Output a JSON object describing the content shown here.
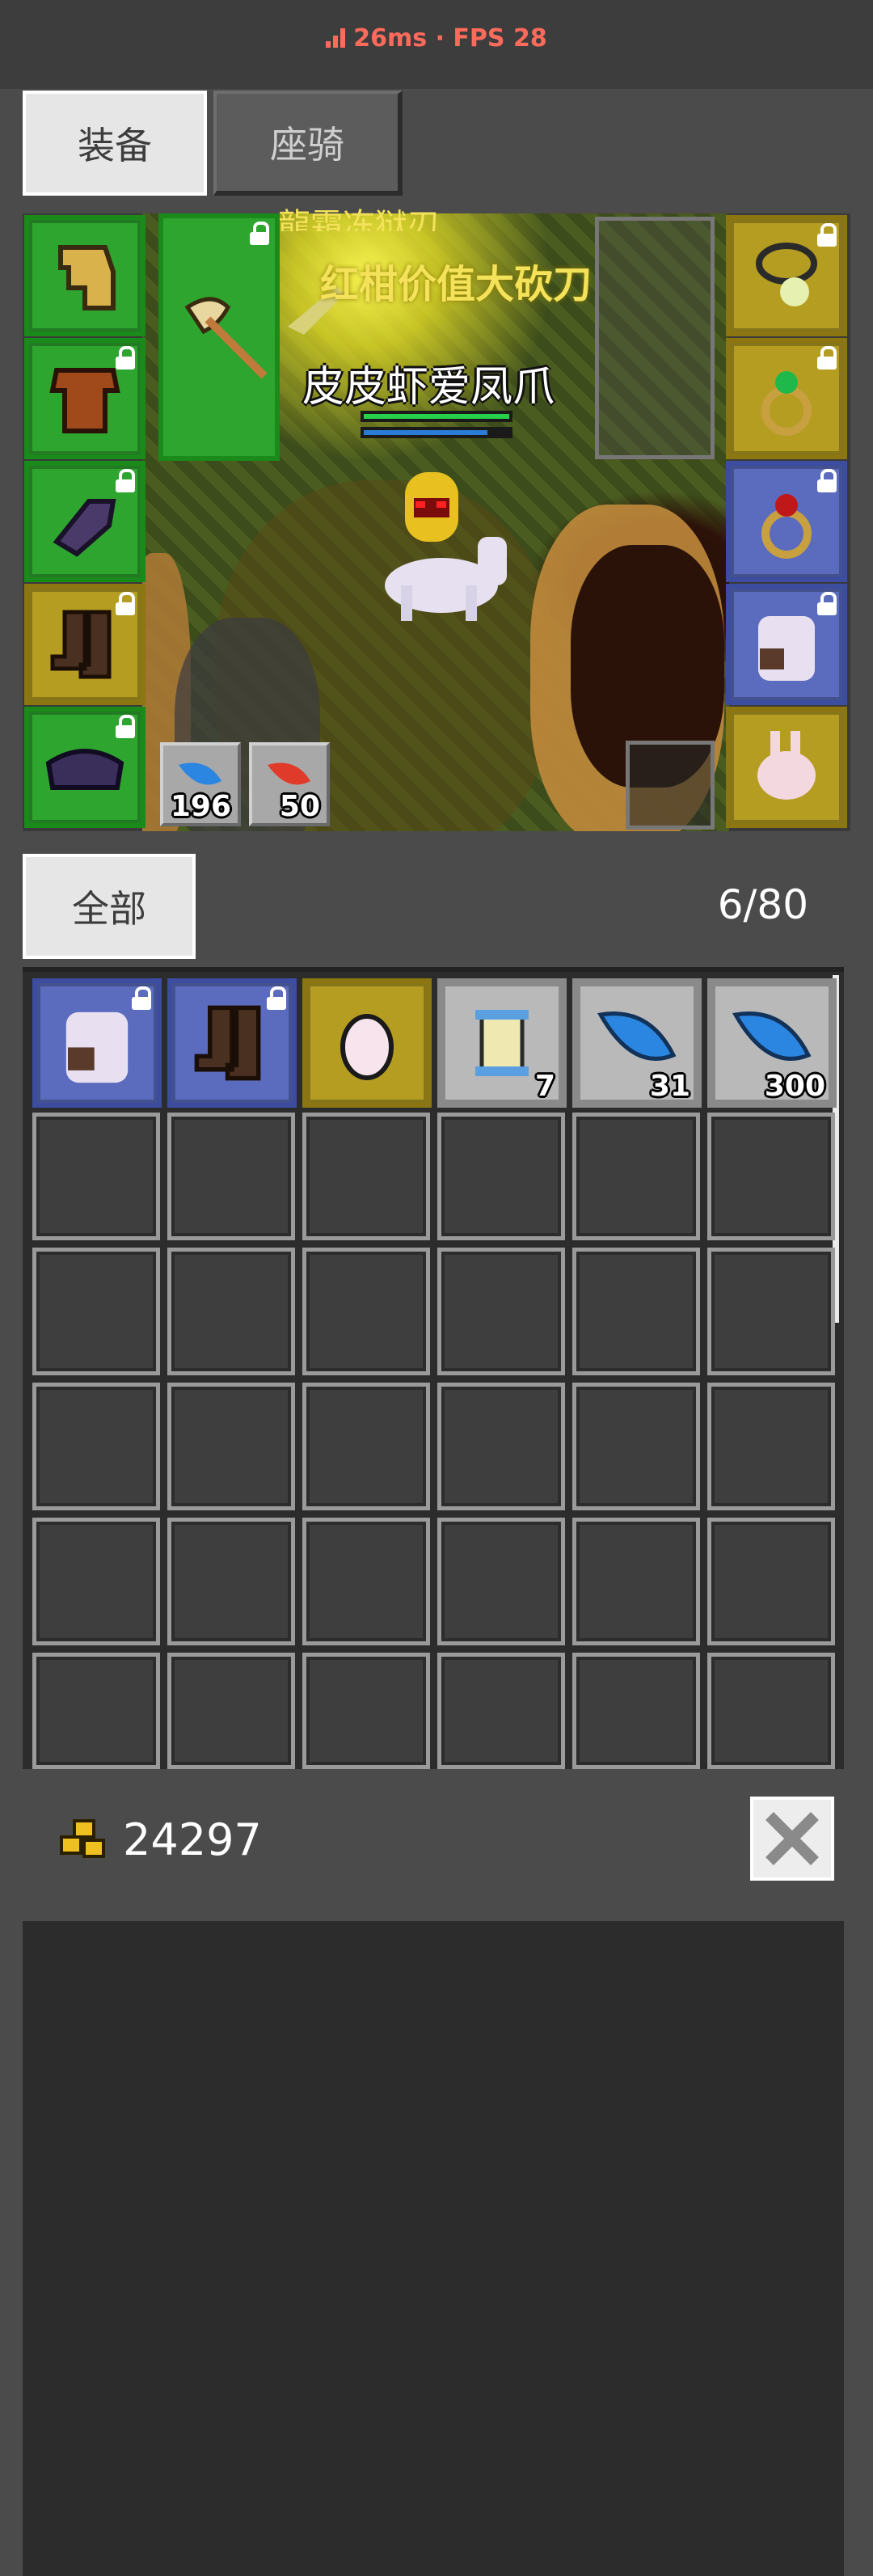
{
  "header": {
    "fps_text": "26ms · FPS 28"
  },
  "tabs": [
    {
      "label": "装备",
      "active": true
    },
    {
      "label": "座骑",
      "active": false
    }
  ],
  "scene": {
    "banner_top": "龍霜冻狱刃",
    "banner": "红柑价值大砍刀",
    "player_name": "皮皮虾爱凤爪",
    "hp_fraction": 1.0,
    "mp_fraction": 0.85
  },
  "equipment": {
    "left_slots": [
      {
        "name": "helmet",
        "color": "green",
        "locked": false,
        "icon": "helmet-icon"
      },
      {
        "name": "armor",
        "color": "green",
        "locked": true,
        "icon": "armor-icon"
      },
      {
        "name": "gloves",
        "color": "green",
        "locked": true,
        "icon": "gloves-icon"
      },
      {
        "name": "boots",
        "color": "yellow",
        "locked": true,
        "icon": "boots-icon"
      },
      {
        "name": "shoulder",
        "color": "green",
        "locked": true,
        "icon": "shoulder-icon"
      }
    ],
    "weapon": {
      "color": "green",
      "locked": true,
      "icon": "axe-icon"
    },
    "right_slots": [
      {
        "name": "necklace",
        "color": "yellow",
        "locked": true,
        "icon": "necklace-icon"
      },
      {
        "name": "ring-green",
        "color": "yellow",
        "locked": true,
        "icon": "ring-icon"
      },
      {
        "name": "ring-red",
        "color": "blue",
        "locked": true,
        "icon": "ring-icon"
      },
      {
        "name": "mount",
        "color": "blue",
        "locked": true,
        "icon": "horse-icon"
      },
      {
        "name": "pet",
        "color": "yellow",
        "locked": false,
        "icon": "rabbit-icon"
      }
    ],
    "potions": [
      {
        "count": "196",
        "color": "#2a86e0"
      },
      {
        "count": "50",
        "color": "#e03a2a"
      }
    ]
  },
  "bag": {
    "filter_label": "全部",
    "count_text": "6/80",
    "items": [
      {
        "icon": "horse-icon",
        "color": "blue",
        "locked": true,
        "count": ""
      },
      {
        "icon": "boots-icon",
        "color": "blue",
        "locked": true,
        "count": ""
      },
      {
        "icon": "egg-icon",
        "color": "yellow",
        "locked": false,
        "count": ""
      },
      {
        "icon": "scroll-icon",
        "color": "grey",
        "locked": false,
        "count": "7"
      },
      {
        "icon": "feather-icon",
        "color": "grey",
        "locked": false,
        "count": "31"
      },
      {
        "icon": "feather-icon",
        "color": "grey",
        "locked": false,
        "count": "300"
      }
    ]
  },
  "footer": {
    "gold": "24297"
  },
  "colors": {
    "green_slot": "#2ea52e",
    "yellow_slot": "#b59d22",
    "blue_slot": "#5b6cbf",
    "fps_text": "#ff6b5b"
  }
}
